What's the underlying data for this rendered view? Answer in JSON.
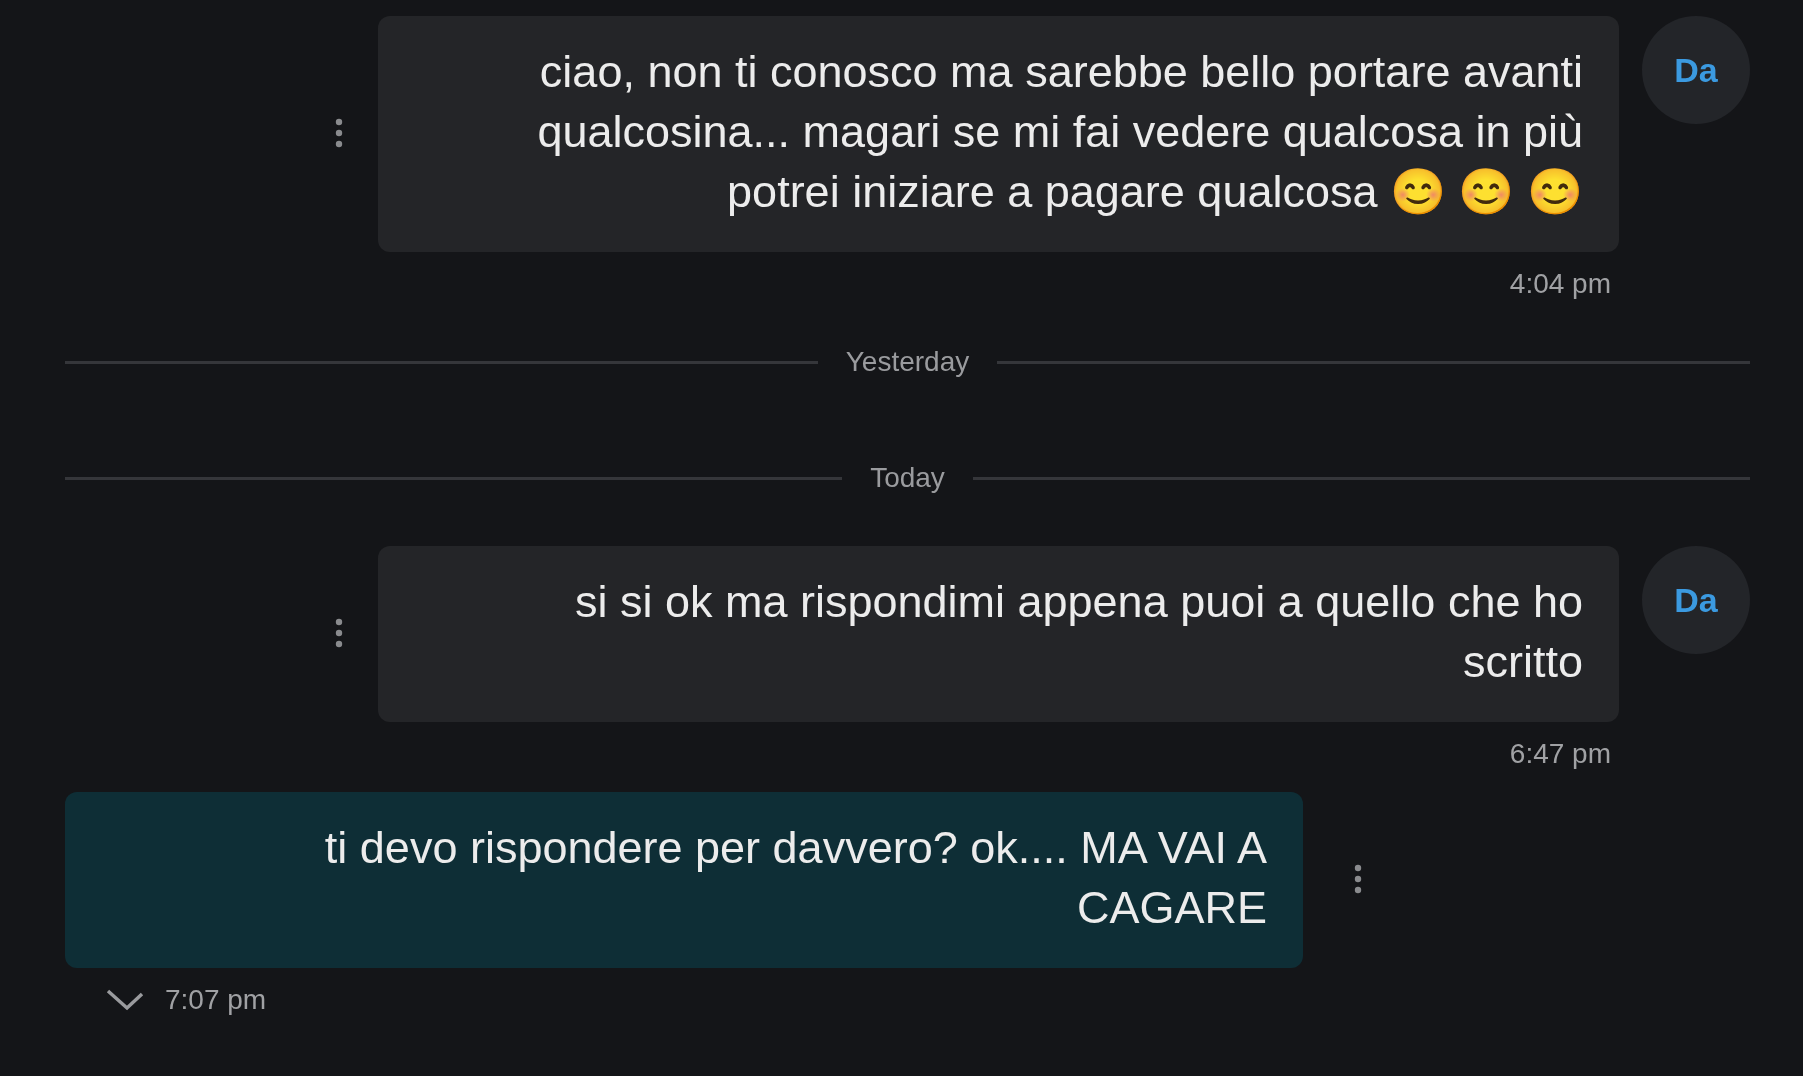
{
  "messages": [
    {
      "kind": "incoming",
      "avatar": "Da",
      "text": "ciao, non ti conosco ma sarebbe bello portare avanti qualcosina... magari se mi fai vedere qualcosa in più potrei iniziare a pagare qualcosa 😊 😊 😊",
      "time": "4:04 pm"
    },
    {
      "kind": "divider",
      "label": "Yesterday"
    },
    {
      "kind": "divider",
      "label": "Today"
    },
    {
      "kind": "incoming",
      "avatar": "Da",
      "text": "si si ok ma rispondimi appena puoi a quello che ho scritto",
      "time": "6:47 pm"
    },
    {
      "kind": "outgoing",
      "text": "ti devo rispondere per davvero? ok.... MA VAI A CAGARE",
      "time": "7:07 pm",
      "read": true
    }
  ]
}
